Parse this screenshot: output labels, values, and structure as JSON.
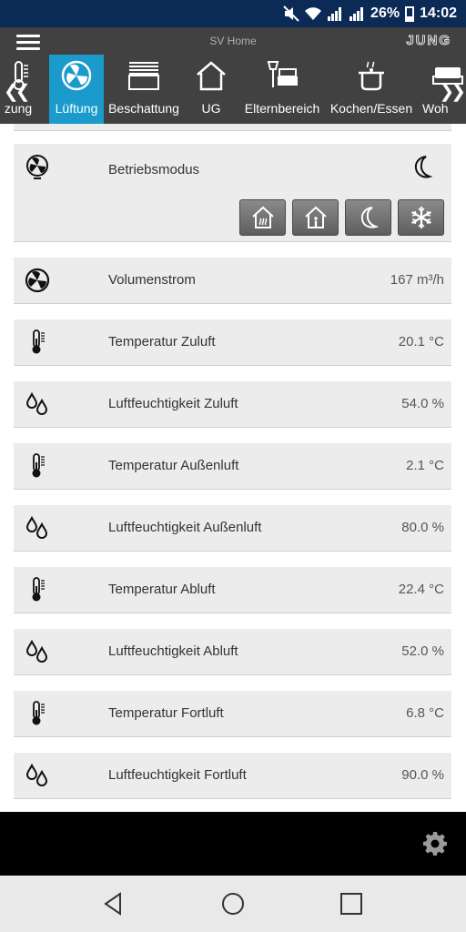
{
  "status_bar": {
    "network1": "3G",
    "network2": "3G",
    "battery": "26%",
    "time": "14:02"
  },
  "app_bar": {
    "title": "SV Home",
    "brand": "JUNG"
  },
  "tabs": [
    {
      "label": "zung",
      "icon": "thermometer-icon",
      "active": false
    },
    {
      "label": "Lüftung",
      "icon": "fan-icon",
      "active": true
    },
    {
      "label": "Beschattung",
      "icon": "blinds-icon",
      "active": false
    },
    {
      "label": "UG",
      "icon": "house-icon",
      "active": false
    },
    {
      "label": "Elternbereich",
      "icon": "bed-lamp-icon",
      "active": false
    },
    {
      "label": "Kochen/Essen",
      "icon": "cooking-pot-icon",
      "active": false
    },
    {
      "label": "Woh",
      "icon": "sofa-icon",
      "active": false
    }
  ],
  "mode": {
    "label": "Betriebsmodus",
    "current_icon": "moon-icon",
    "buttons": [
      {
        "name": "mode-button-home-heat",
        "icon": "house-heat-icon"
      },
      {
        "name": "mode-button-home",
        "icon": "house-person-icon"
      },
      {
        "name": "mode-button-night",
        "icon": "moon-icon"
      },
      {
        "name": "mode-button-frost",
        "icon": "snowflake-icon"
      }
    ]
  },
  "rows": [
    {
      "label": "Volumenstrom",
      "value": "167 m³/h",
      "icon": "fan-icon"
    },
    {
      "label": "Temperatur Zuluft",
      "value": "20.1 °C",
      "icon": "thermometer-icon"
    },
    {
      "label": "Luftfeuchtigkeit Zuluft",
      "value": "54.0 %",
      "icon": "droplets-icon"
    },
    {
      "label": "Temperatur Außenluft",
      "value": "2.1 °C",
      "icon": "thermometer-icon"
    },
    {
      "label": "Luftfeuchtigkeit Außenluft",
      "value": "80.0 %",
      "icon": "droplets-icon"
    },
    {
      "label": "Temperatur Abluft",
      "value": "22.4 °C",
      "icon": "thermometer-icon"
    },
    {
      "label": "Luftfeuchtigkeit Abluft",
      "value": "52.0 %",
      "icon": "droplets-icon"
    },
    {
      "label": "Temperatur Fortluft",
      "value": "6.8 °C",
      "icon": "thermometer-icon"
    },
    {
      "label": "Luftfeuchtigkeit Fortluft",
      "value": "90.0 %",
      "icon": "droplets-icon"
    }
  ],
  "colors": {
    "status_bar": "#0b2a55",
    "app_bar": "#414141",
    "active_tab": "#1a9bcb",
    "card": "#ececec"
  }
}
